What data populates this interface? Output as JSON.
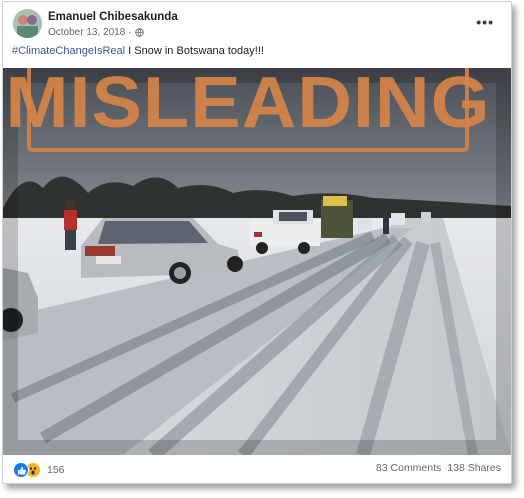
{
  "post": {
    "author": "Emanuel Chibesakunda",
    "date": "October 13, 2018",
    "date_separator": "·",
    "privacy_icon": "globe-icon",
    "more_icon": "more-horizontal-icon",
    "caption_hashtag": "#ClimateChangeIsReal",
    "caption_text": " I Snow in Botswana today!!!",
    "stamp_text": "MISLEADING"
  },
  "stats": {
    "reactions_count": "156",
    "reaction_icons": [
      "like-icon",
      "wow-icon"
    ],
    "comments": "83 Comments",
    "shares": "138 Shares"
  },
  "colors": {
    "hashtag": "#385898",
    "stamp": "#d68448",
    "like": "#1877f2",
    "wow": "#f7b125"
  }
}
